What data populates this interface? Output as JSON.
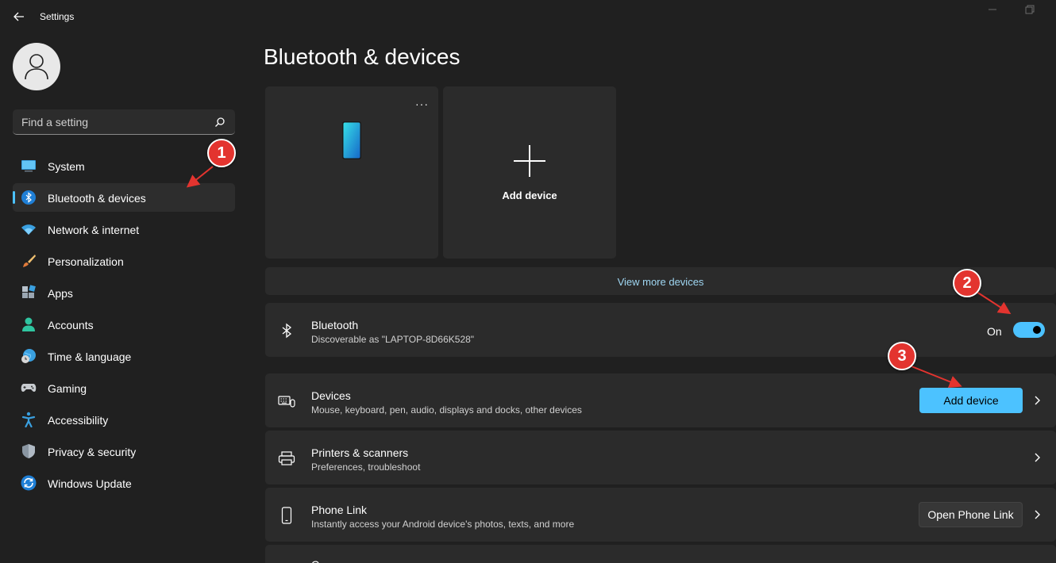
{
  "window": {
    "title": "Settings"
  },
  "search": {
    "placeholder": "Find a setting"
  },
  "sidebar": {
    "items": [
      {
        "label": "System"
      },
      {
        "label": "Bluetooth & devices"
      },
      {
        "label": "Network & internet"
      },
      {
        "label": "Personalization"
      },
      {
        "label": "Apps"
      },
      {
        "label": "Accounts"
      },
      {
        "label": "Time & language"
      },
      {
        "label": "Gaming"
      },
      {
        "label": "Accessibility"
      },
      {
        "label": "Privacy & security"
      },
      {
        "label": "Windows Update"
      }
    ],
    "active_index": 1
  },
  "main": {
    "title": "Bluetooth & devices",
    "device_card": {
      "more_label": "···"
    },
    "add_card": {
      "label": "Add device"
    },
    "view_more": "View more devices",
    "bluetooth": {
      "title": "Bluetooth",
      "subtitle": "Discoverable as \"LAPTOP-8D66K528\"",
      "toggle_label": "On",
      "toggle_on": true
    },
    "devices": {
      "title": "Devices",
      "subtitle": "Mouse, keyboard, pen, audio, displays and docks, other devices",
      "button": "Add device"
    },
    "printers": {
      "title": "Printers & scanners",
      "subtitle": "Preferences, troubleshoot"
    },
    "phone_link": {
      "title": "Phone Link",
      "subtitle": "Instantly access your Android device's photos, texts, and more",
      "button": "Open Phone Link"
    },
    "next_row": {
      "title": "C"
    }
  },
  "annotations": [
    {
      "label": "1"
    },
    {
      "label": "2"
    },
    {
      "label": "3"
    }
  ],
  "colors": {
    "background": "#202020",
    "card": "#2b2b2b",
    "accent": "#4cc2ff",
    "link": "#9fd6f2",
    "annotation": "#e3342f"
  }
}
